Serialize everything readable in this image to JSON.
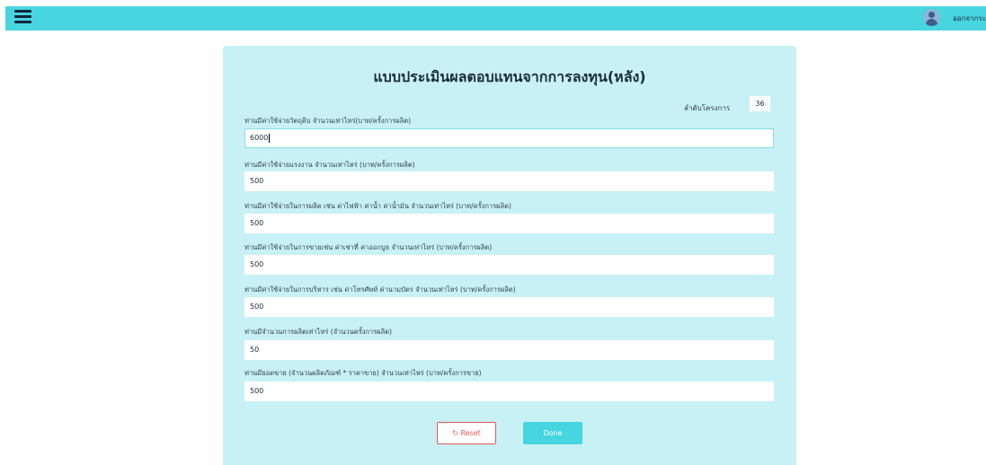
{
  "topbar": {
    "menu_icon": "hamburger-menu-icon",
    "avatar_icon": "user-avatar-icon",
    "logout_label": "ออกจากระบ"
  },
  "form": {
    "title": "แบบประเมินผลตอบแทนจากการลงทุน(หลัง)",
    "project_order_label": "ลำดับโครงการ",
    "project_order_value": "36",
    "fields": [
      {
        "label": "ท่านมีค่าใช้จ่ายวัตถุดิบ จำนวนเท่าไหร่(บาท/ครั้งการผลิต)",
        "value": "6000"
      },
      {
        "label": "ท่านมีค่าใช้จ่ายแรงงาน จำนวนเท่าไหร่ (บาท/ครั้งการผลิต)",
        "value": "500"
      },
      {
        "label": "ท่านมีค่าใช้จ่ายในการผลิต เช่น ค่าไฟฟ้า ค่าน้ำ ค่าน้ำมัน จำนวนเท่าไหร่ (บาท/ครั้งการผลิต)",
        "value": "500"
      },
      {
        "label": "ท่านมีค่าใช้จ่ายในการขายเช่น ค่าเช่าที่ ค่าออกบูธ จำนวนเท่าไหร่ (บาท/ครั้งการผลิต)",
        "value": "500"
      },
      {
        "label": "ท่านมีค่าใช้จ่ายในการบริหาร เช่น ค่าโทรศัพท์ ค่านามบัตร จำนวนเท่าไหร่ (บาท/ครั้งการผลิต)",
        "value": "500"
      },
      {
        "label": "ท่านมีจำนวนการผลิตเท่าไหร่ (จำนวนครั้งการผลิต)",
        "value": "50"
      },
      {
        "label": "ท่านมียอดขาย (จำนวนผลิตภัณฑ์ * ราคาขาย) จำนวนเท่าไหร่ (บาท/ครั้งการขาย)",
        "value": "500"
      }
    ],
    "reset_icon": "↻",
    "reset_label": "Reset",
    "done_label": "Done"
  },
  "colors": {
    "topbar": "#47d5e0",
    "card": "#c8f1f5",
    "reset": "#e05a5a",
    "done": "#47d5e0"
  }
}
